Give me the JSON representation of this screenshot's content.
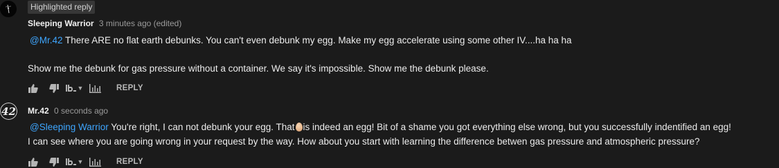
{
  "comments": [
    {
      "badge": "Highlighted reply",
      "author": "Sleeping Warrior",
      "time": "3 minutes ago (edited)",
      "mention": "@Mr.42",
      "line1": " There ARE no flat earth debunks. You can't even debunk my egg. Make my egg accelerate using some other IV....ha ha ha",
      "line2": "Show me the debunk for gas pressure without a container. We say it's impossible. Show me the debunk please.",
      "reply_label": "REPLY"
    },
    {
      "author": "Mr.42",
      "avatar_text": "42",
      "time": "0 seconds ago",
      "mention": "@Sleeping Warrior",
      "line1_a": " You're right, I can not debunk your egg. That",
      "line1_b": "is indeed an egg! Bit of a shame you got everything else wrong, but you successfully indentified an egg!",
      "line2": "I can see where you are going wrong in your request by the way. How about you start with learning the difference betwen gas pressure and atmospheric pressure?",
      "reply_label": "REPLY"
    }
  ],
  "icons": {
    "like": "thumbs-up-icon",
    "dislike": "thumbs-down-icon",
    "tb": "tb-icon",
    "caret": "caret-down-icon",
    "stats": "stats-icon"
  },
  "colors": {
    "background": "#1b1b1b",
    "mention": "#3ea6ff",
    "text": "#ececec",
    "muted": "#9b9b9b"
  }
}
